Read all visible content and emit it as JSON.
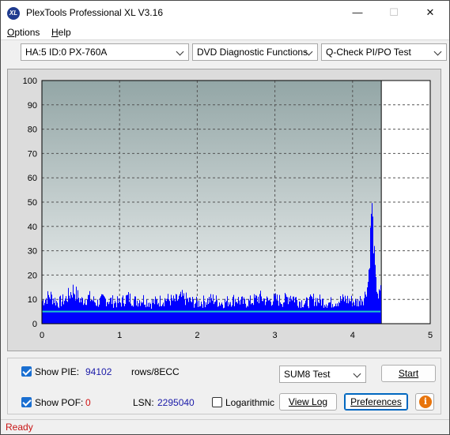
{
  "window": {
    "title": "PlexTools Professional XL V3.16",
    "icon": "XL",
    "min": "—",
    "max": "☐",
    "close": "✕"
  },
  "menu": [
    {
      "label_ul": "O",
      "label_rest": "ptions"
    },
    {
      "label_ul": "H",
      "label_rest": "elp"
    }
  ],
  "toolbar": {
    "drive": "HA:5 ID:0  PX-760A",
    "function": "DVD Diagnostic Functions",
    "test": "Q-Check PI/PO Test"
  },
  "chart_data": {
    "type": "bar",
    "title": "",
    "xlabel": "",
    "ylabel": "",
    "xlim": [
      0,
      5
    ],
    "ylim": [
      0,
      100
    ],
    "x_ticks": [
      "0",
      "1",
      "2",
      "3",
      "4",
      "5"
    ],
    "y_ticks": [
      "0",
      "10",
      "20",
      "30",
      "40",
      "50",
      "60",
      "70",
      "80",
      "90",
      "100"
    ],
    "grid": true,
    "scan_end": 4.37,
    "series": [
      {
        "kind": "pie-bars",
        "color": "#0000ff",
        "x": [
          0.0,
          0.1,
          0.2,
          0.3,
          0.4,
          0.5,
          0.6,
          0.7,
          0.8,
          0.9,
          1.0,
          1.1,
          1.2,
          1.3,
          1.4,
          1.5,
          1.6,
          1.7,
          1.8,
          1.9,
          2.0,
          2.1,
          2.2,
          2.3,
          2.4,
          2.5,
          2.6,
          2.7,
          2.8,
          2.9,
          3.0,
          3.1,
          3.2,
          3.3,
          3.4,
          3.5,
          3.6,
          3.7,
          3.8,
          3.9,
          4.0,
          4.05,
          4.1,
          4.15,
          4.18,
          4.2,
          4.22,
          4.24,
          4.26,
          4.28,
          4.3,
          4.33,
          4.36
        ],
        "y": [
          12,
          15,
          11,
          13,
          18,
          12,
          14,
          11,
          13,
          12,
          11,
          14,
          12,
          13,
          11,
          12,
          13,
          12,
          14,
          12,
          11,
          12,
          13,
          11,
          12,
          13,
          11,
          12,
          14,
          12,
          13,
          12,
          15,
          12,
          11,
          13,
          12,
          11,
          12,
          13,
          12,
          11,
          13,
          14,
          16,
          22,
          35,
          59,
          45,
          30,
          18,
          14,
          17
        ]
      },
      {
        "kind": "pif-line",
        "color": "#1ec8c8",
        "x": [
          0.0,
          0.2,
          0.5,
          1.0,
          1.5,
          2.0,
          2.5,
          3.0,
          3.5,
          4.0,
          4.2,
          4.36
        ],
        "y": [
          5,
          5,
          5,
          5,
          5,
          5,
          5,
          5,
          5,
          5,
          5,
          5
        ]
      }
    ]
  },
  "controls": {
    "show_pie_label": "Show PIE:",
    "show_pie_value": "94102",
    "rows_label": "rows/8ECC",
    "show_pof_label": "Show POF:",
    "show_pof_value": "0",
    "lsn_label": "LSN:",
    "lsn_value": "2295040",
    "logarithmic_label": "Logarithmic",
    "sum_select": "SUM8 Test",
    "start": "Start",
    "view_log": "View Log",
    "preferences": "Preferences",
    "info": "i"
  },
  "status": "Ready"
}
